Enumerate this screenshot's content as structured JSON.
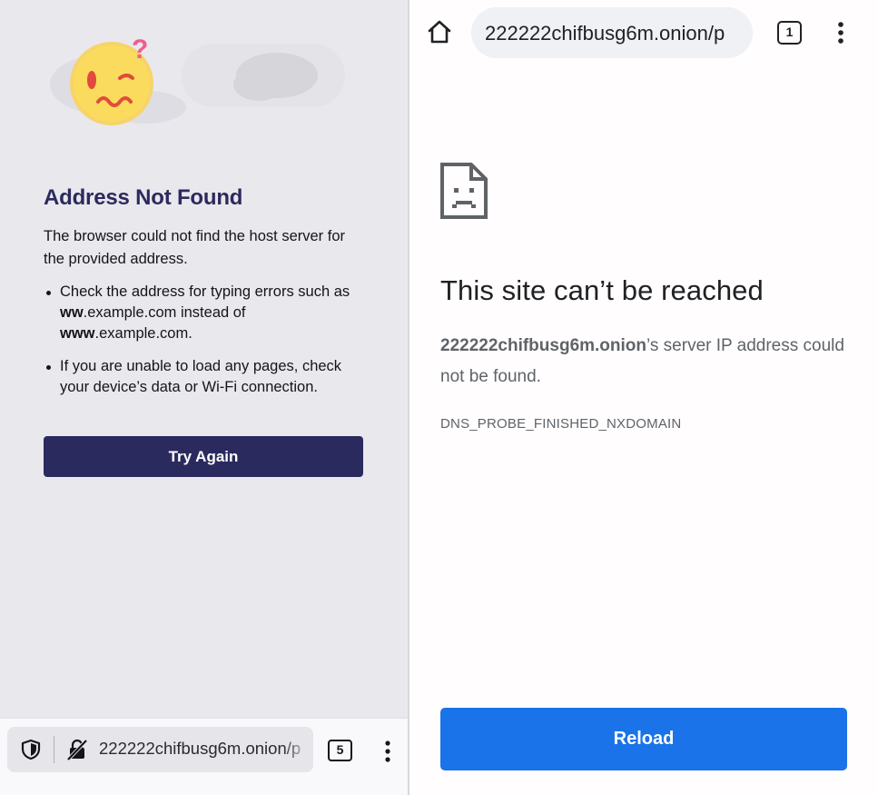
{
  "left_pane": {
    "error_title": "Address Not Found",
    "error_description": "The browser could not find the host server for the provided address.",
    "tips": [
      {
        "pre": "Check the address for typing errors such as ",
        "bold1": "ww",
        "mid": ".example.com instead of ",
        "bold2": "www",
        "post": ".example.com."
      },
      {
        "text": "If you are unable to load any pages, check your device’s data or Wi-Fi connection."
      }
    ],
    "try_again_label": "Try Again",
    "toolbar": {
      "url": "222222chifbusg6m.onion/p",
      "tab_count": "5",
      "icons": [
        "shield-icon",
        "lock-slash-icon",
        "more-vert-icon"
      ]
    },
    "colors": {
      "accent": "#2b2a5e",
      "background": "#e9e8ec"
    }
  },
  "right_pane": {
    "toolbar": {
      "url": "222222chifbusg6m.onion/p",
      "tab_count": "1",
      "icons": [
        "home-icon",
        "more-vert-icon"
      ]
    },
    "error_icon": "sad-document-icon",
    "error_title": "This site can’t be reached",
    "host": "222222chifbusg6m.onion",
    "error_suffix": "’s server IP address could not be found.",
    "error_code": "DNS_PROBE_FINISHED_NXDOMAIN",
    "reload_label": "Reload",
    "colors": {
      "button": "#1a73e8",
      "text": "#202124"
    }
  }
}
